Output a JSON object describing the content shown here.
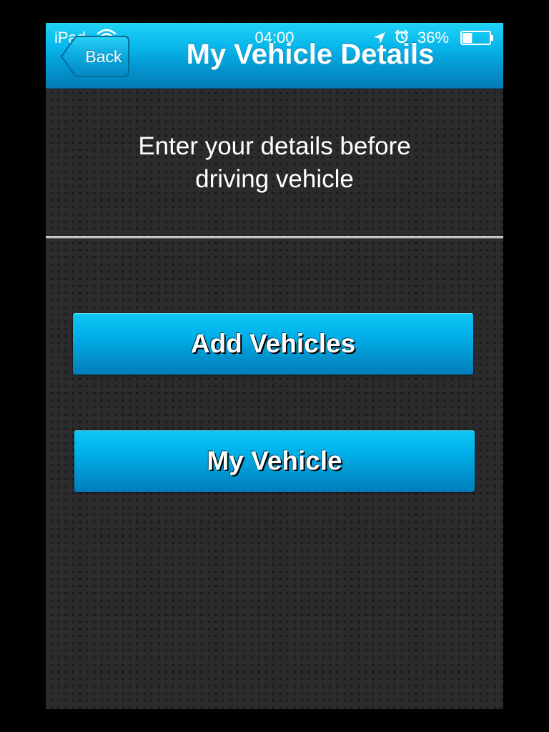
{
  "status_bar": {
    "device": "iPad",
    "time": "04:00",
    "battery_percent": "36%",
    "battery_level": 0.36,
    "icons": [
      "wifi-icon",
      "location-arrow-icon",
      "alarm-clock-icon",
      "battery-icon"
    ]
  },
  "nav_bar": {
    "back_label": "Back",
    "title": "My Vehicle Details"
  },
  "main": {
    "instruction_line1": "Enter your details before",
    "instruction_line2": "driving vehicle",
    "buttons": [
      {
        "label": "Add Vehicles"
      },
      {
        "label": "My Vehicle"
      }
    ]
  },
  "colors": {
    "accent": "#08b8ec",
    "background": "#2b2b2d",
    "text": "#ffffff"
  }
}
